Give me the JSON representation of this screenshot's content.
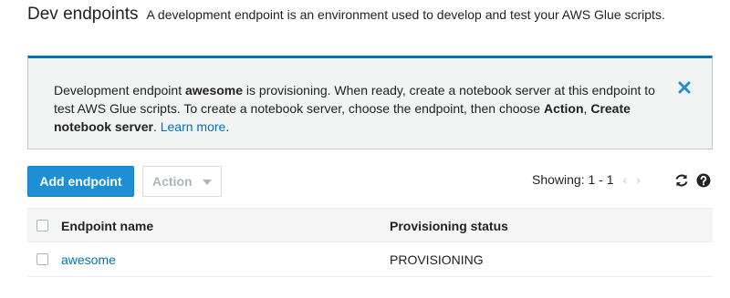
{
  "header": {
    "title": "Dev endpoints",
    "description": "A development endpoint is an environment used to develop and test your AWS Glue scripts."
  },
  "banner": {
    "part1": "Development endpoint ",
    "endpoint_name": "awesome",
    "part2": " is provisioning. When ready, create a notebook server at this endpoint to test AWS Glue scripts. To create a notebook server, choose the endpoint, then choose ",
    "action_label": "Action",
    "sep": ", ",
    "create_label": "Create notebook server",
    "part3": ". ",
    "learn_more": "Learn more",
    "end": ".",
    "close_icon": "close-icon",
    "accent": "#0073bb"
  },
  "toolbar": {
    "add_label": "Add endpoint",
    "action_label": "Action",
    "showing": "Showing: 1 - 1",
    "prev": "‹",
    "next": "›",
    "refresh_icon": "refresh-icon",
    "help_icon": "help-icon",
    "primary_color": "#1e8fd5"
  },
  "table": {
    "columns": [
      "Endpoint name",
      "Provisioning status"
    ],
    "rows": [
      {
        "name": "awesome",
        "status": "PROVISIONING"
      }
    ]
  }
}
